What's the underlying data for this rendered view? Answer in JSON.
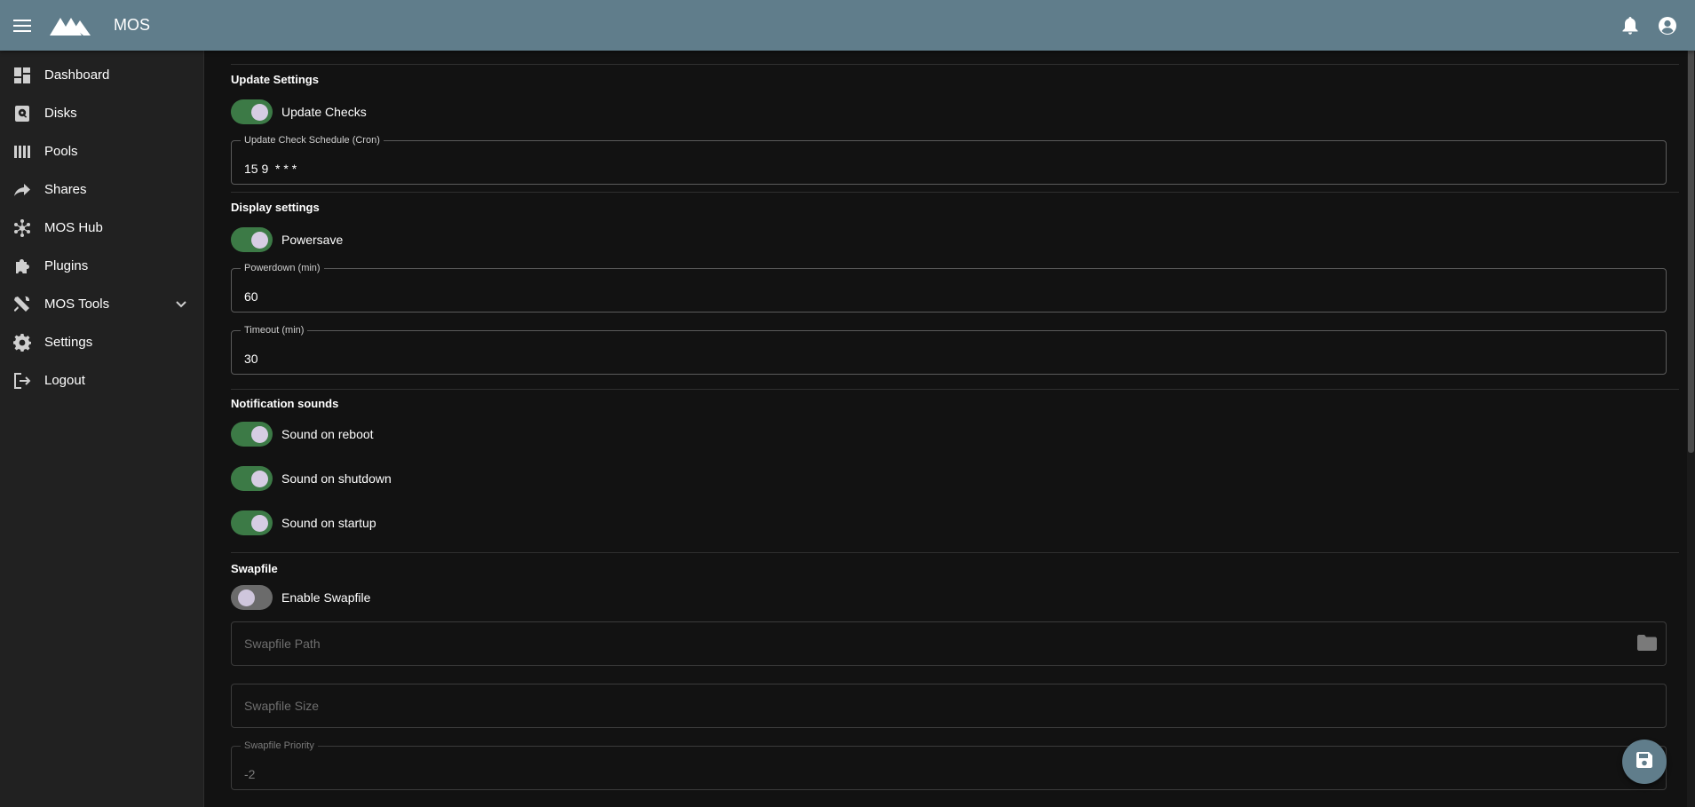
{
  "app": {
    "title": "MOS",
    "colors": {
      "appbar": "#607d8b",
      "accent_on": "#3c7a46",
      "background": "#121212",
      "sidebar": "#212121"
    }
  },
  "header": {
    "menu_icon": "menu-icon",
    "logo": "mos-logo",
    "notifications_icon": "bell-icon",
    "account_icon": "account-circle-icon"
  },
  "sidebar": {
    "items": [
      {
        "label": "Dashboard",
        "icon": "dashboard-icon"
      },
      {
        "label": "Disks",
        "icon": "disk-icon"
      },
      {
        "label": "Pools",
        "icon": "pools-icon"
      },
      {
        "label": "Shares",
        "icon": "share-icon"
      },
      {
        "label": "MOS Hub",
        "icon": "hub-icon"
      },
      {
        "label": "Plugins",
        "icon": "puzzle-icon"
      },
      {
        "label": "MOS Tools",
        "icon": "tools-icon",
        "expandable": true
      },
      {
        "label": "Settings",
        "icon": "gear-icon"
      },
      {
        "label": "Logout",
        "icon": "logout-icon"
      }
    ]
  },
  "update": {
    "title": "Update Settings",
    "checks_label": "Update Checks",
    "checks_on": true,
    "schedule_label": "Update Check Schedule (Cron)",
    "schedule_value": "15 9  * * *"
  },
  "display": {
    "title": "Display settings",
    "powersave_label": "Powersave",
    "powersave_on": true,
    "powerdown_label": "Powerdown (min)",
    "powerdown_value": "60",
    "timeout_label": "Timeout (min)",
    "timeout_value": "30"
  },
  "sounds": {
    "title": "Notification sounds",
    "reboot_label": "Sound on reboot",
    "shutdown_label": "Sound on shutdown",
    "startup_label": "Sound on startup"
  },
  "swapfile": {
    "title": "Swapfile",
    "enable_label": "Enable Swapfile",
    "enabled": false,
    "path_placeholder": "Swapfile Path",
    "size_placeholder": "Swapfile Size",
    "priority_label": "Swapfile Priority",
    "priority_value": "-2"
  },
  "fab": {
    "icon": "save-icon"
  }
}
